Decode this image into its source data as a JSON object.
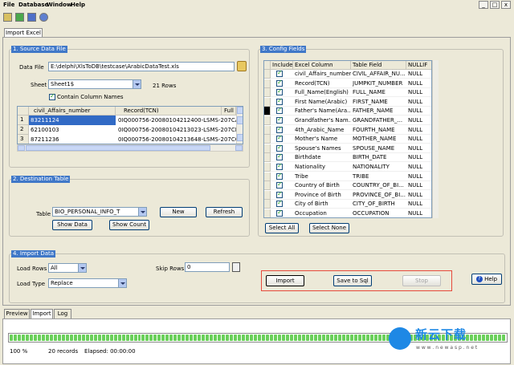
{
  "menu": [
    "File",
    "Database",
    "Window",
    "Help"
  ],
  "window_controls": [
    "_",
    "□",
    "x"
  ],
  "main_tab": "Import Excel",
  "source": {
    "title": "1. Source Data File",
    "data_file_label": "Data File",
    "data_file_value": "E:\\delphi\\XlsToDB\\testcase\\ArabicDataTest.xls",
    "sheet_label": "Sheet",
    "sheet_value": "Sheet1$",
    "rows_text": "21 Rows",
    "contain_names_label": "Contain Column Names",
    "grid_headers": [
      "civil_Affairs_number",
      "Record(TCN)",
      "Full"
    ],
    "grid_rows": [
      {
        "num": "1",
        "a": "83211124",
        "b": "0IQ000756-20080104212400-LSMS-207CA"
      },
      {
        "num": "2",
        "a": "62100103",
        "b": "0IQ000756-20080104213023-LSMS-207CB"
      },
      {
        "num": "3",
        "a": "87211236",
        "b": "0IQ000756-20080104213648-LSMS-207CC"
      }
    ]
  },
  "destination": {
    "title": "2. Destination Table",
    "table_label": "Table",
    "table_value": "BIO_PERSONAL_INFO_T",
    "new_button": "New",
    "refresh_button": "Refresh",
    "show_data_button": "Show Data",
    "show_count_button": "Show Count"
  },
  "config": {
    "title": "3. Config Fields",
    "headers": [
      "Include",
      "Excel Column",
      "Table Field",
      "NULLIF"
    ],
    "rows": [
      {
        "excel": "civil_Affairs_number",
        "field": "CIVIL_AFFAIR_NU...",
        "nullif": "NULL"
      },
      {
        "excel": "Record(TCN)",
        "field": "JUMPKIT_NUMBER",
        "nullif": "NULL"
      },
      {
        "excel": "Full_Name(English)",
        "field": "FULL_NAME",
        "nullif": "NULL"
      },
      {
        "excel": "First Name(Arabic)",
        "field": "FIRST_NAME",
        "nullif": "NULL"
      },
      {
        "excel": "Father's Name(Ara...",
        "field": "FATHER_NAME",
        "nullif": "NULL"
      },
      {
        "excel": "Grandfather's Nam...",
        "field": "GRANDFATHER_...",
        "nullif": "NULL"
      },
      {
        "excel": "4th_Arabic_Name",
        "field": "FOURTH_NAME",
        "nullif": "NULL"
      },
      {
        "excel": "Mother's Name",
        "field": "MOTHER_NAME",
        "nullif": "NULL"
      },
      {
        "excel": "Spouse's Names",
        "field": "SPOUSE_NAME",
        "nullif": "NULL"
      },
      {
        "excel": "Birthdate",
        "field": "BIRTH_DATE",
        "nullif": "NULL"
      },
      {
        "excel": "Nationality",
        "field": "NATIONALITY",
        "nullif": "NULL"
      },
      {
        "excel": "Tribe",
        "field": "TRIBE",
        "nullif": "NULL"
      },
      {
        "excel": "Country of Birth",
        "field": "COUNTRY_OF_BI...",
        "nullif": "NULL"
      },
      {
        "excel": "Province of Birth",
        "field": "PROVINCE_OF_BI...",
        "nullif": "NULL"
      },
      {
        "excel": "City of Birth",
        "field": "CITY_OF_BIRTH",
        "nullif": "NULL"
      },
      {
        "excel": "Occupation",
        "field": "OCCUPATION",
        "nullif": "NULL"
      }
    ],
    "select_all_button": "Select All",
    "select_none_button": "Select None"
  },
  "import_data": {
    "title": "4. Import Data",
    "load_rows_label": "Load Rows",
    "load_rows_value": "All",
    "skip_rows_label": "Skip Rows",
    "skip_rows_value": "0",
    "load_type_label": "Load Type",
    "load_type_value": "Replace",
    "import_button": "Import",
    "save_sql_button": "Save to Sql",
    "stop_button": "Stop",
    "help_button": "Help"
  },
  "bottom_tabs": [
    "Preview",
    "Import",
    "Log"
  ],
  "progress": {
    "percent_text": "100 %",
    "percent": 100,
    "records_text": "20 records",
    "elapsed_text": "Elapsed: 00:00:00"
  },
  "watermark": {
    "brand": "新云下载",
    "url": "w w w . n e w a s p . n e t"
  },
  "colors": {
    "accent_title": "#4078C8",
    "highlight": "#E64A3C",
    "progress": "#6AD05A",
    "selection": "#316AC5"
  }
}
